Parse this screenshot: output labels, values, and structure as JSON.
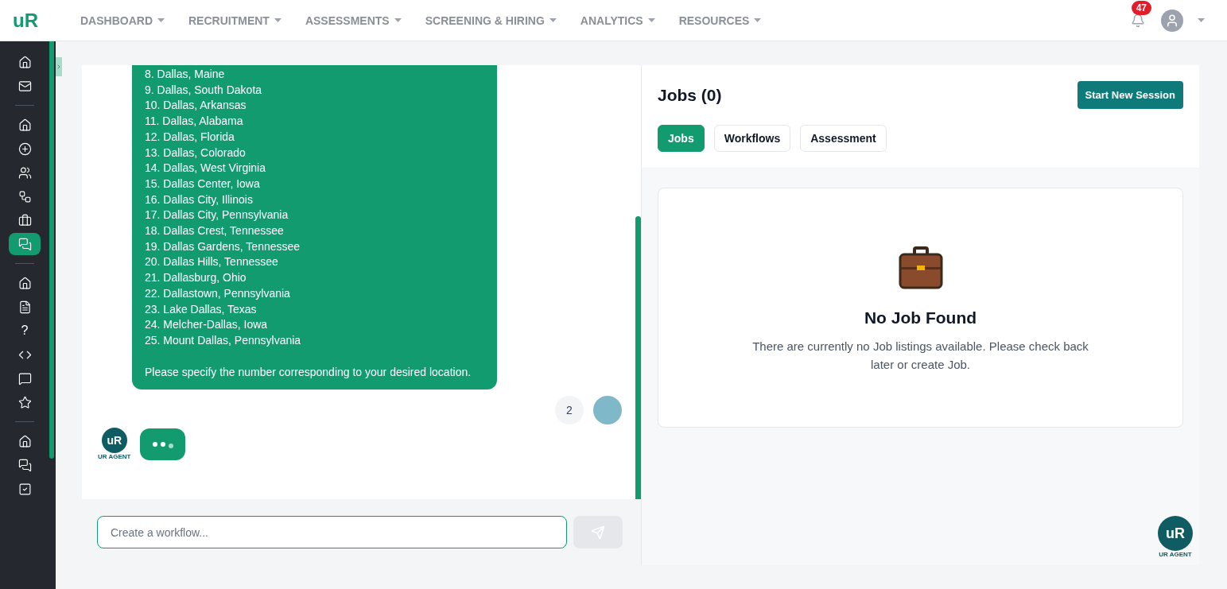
{
  "logo": "uR",
  "nav": [
    {
      "label": "DASHBOARD"
    },
    {
      "label": "RECRUITMENT"
    },
    {
      "label": "ASSESSMENTS"
    },
    {
      "label": "SCREENING & HIRING"
    },
    {
      "label": "ANALYTICS"
    },
    {
      "label": "RESOURCES"
    }
  ],
  "notifications": {
    "count": "47"
  },
  "sidebar": {
    "groups": [
      [
        {
          "kind": "home",
          "selected": false
        },
        {
          "kind": "mail",
          "selected": false
        }
      ],
      [
        {
          "kind": "home",
          "selected": false
        },
        {
          "kind": "plus",
          "selected": false
        },
        {
          "kind": "users",
          "selected": false
        },
        {
          "kind": "flow",
          "selected": false
        },
        {
          "kind": "briefcase",
          "selected": false
        },
        {
          "kind": "chat",
          "selected": true
        }
      ],
      [
        {
          "kind": "home",
          "selected": false
        },
        {
          "kind": "file",
          "selected": false
        },
        {
          "kind": "text",
          "label": "?",
          "selected": false
        },
        {
          "kind": "code",
          "selected": false
        },
        {
          "kind": "review",
          "selected": false
        },
        {
          "kind": "star",
          "selected": false
        }
      ],
      [
        {
          "kind": "home",
          "selected": false
        },
        {
          "kind": "chat",
          "selected": false
        },
        {
          "kind": "check",
          "selected": false
        }
      ]
    ]
  },
  "chat": {
    "bot_lines": [
      "8. Dallas, Maine",
      "9. Dallas, South Dakota",
      "10. Dallas, Arkansas",
      "11. Dallas, Alabama",
      "12. Dallas, Florida",
      "13. Dallas, Colorado",
      "14. Dallas, West Virginia",
      "15. Dallas Center, Iowa",
      "16. Dallas City, Illinois",
      "17. Dallas City, Pennsylvania",
      "18. Dallas Crest, Tennessee",
      "19. Dallas Gardens, Tennessee",
      "20. Dallas Hills, Tennessee",
      "21. Dallasburg, Ohio",
      "22. Dallastown, Pennsylvania",
      "23. Lake Dallas, Texas",
      "24. Melcher-Dallas, Iowa",
      "25. Mount Dallas, Pennsylvania"
    ],
    "bot_prompt": "Please specify the number corresponding to your desired location.",
    "user_message": "2",
    "agent_logo": "uR",
    "agent_label": "UR AGENT",
    "input": {
      "placeholder": "Create a workflow..."
    }
  },
  "jobs": {
    "title": "Jobs (0)",
    "new_session": "Start New Session",
    "tabs": [
      {
        "label": "Jobs",
        "selected": true
      },
      {
        "label": "Workflows",
        "selected": false
      },
      {
        "label": "Assessment",
        "selected": false
      }
    ],
    "empty": {
      "title": "No Job Found",
      "message": "There are currently no Job listings available. Please check back later or create Job."
    }
  },
  "floating_agent": {
    "logo": "uR",
    "label": "UR AGENT"
  }
}
